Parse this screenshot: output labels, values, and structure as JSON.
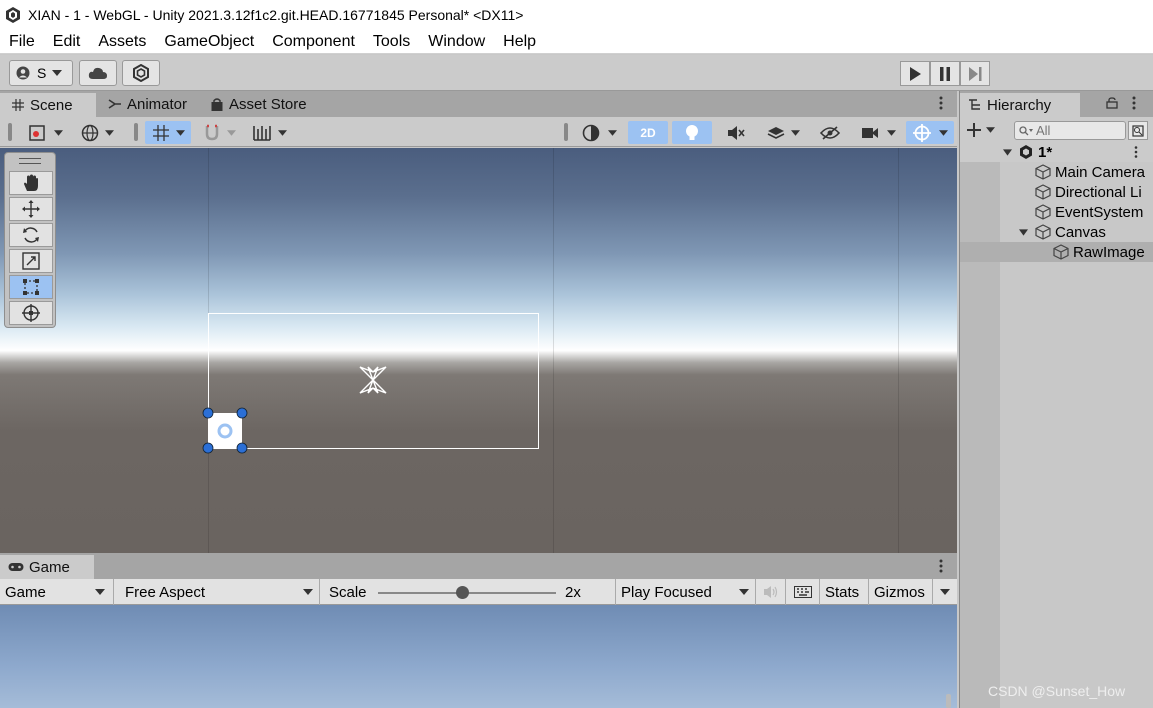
{
  "window": {
    "title": "XIAN - 1 - WebGL - Unity 2021.3.12f1c2.git.HEAD.16771845 Personal* <DX11>"
  },
  "menu": [
    "File",
    "Edit",
    "Assets",
    "GameObject",
    "Component",
    "Tools",
    "Window",
    "Help"
  ],
  "toolbar": {
    "account_label": "S"
  },
  "scene_tabs": [
    {
      "label": "Scene"
    },
    {
      "label": "Animator"
    },
    {
      "label": "Asset Store"
    }
  ],
  "scene_toolbar": {
    "mode_2d": "2D"
  },
  "game_tab": {
    "label": "Game"
  },
  "game_toolbar": {
    "display": "Game",
    "aspect": "Free Aspect",
    "scale_label": "Scale",
    "scale_value": "2x",
    "scale_level": 0.47,
    "play_mode": "Play Focused",
    "stats": "Stats",
    "gizmos": "Gizmos"
  },
  "hierarchy": {
    "tab_label": "Hierarchy",
    "search_placeholder": "All",
    "scene_name": "1*",
    "items": [
      {
        "label": "Main Camera",
        "depth": 1
      },
      {
        "label": "Directional Li",
        "depth": 1
      },
      {
        "label": "EventSystem",
        "depth": 1
      },
      {
        "label": "Canvas",
        "depth": 1
      },
      {
        "label": "RawImage",
        "depth": 2
      }
    ]
  },
  "watermark": "CSDN @Sunset_How",
  "colors": {
    "accent": "#9cc2f2",
    "handle": "#2b6fd6",
    "sky_top": "#4a5d7e",
    "ground": "#6a6460"
  }
}
